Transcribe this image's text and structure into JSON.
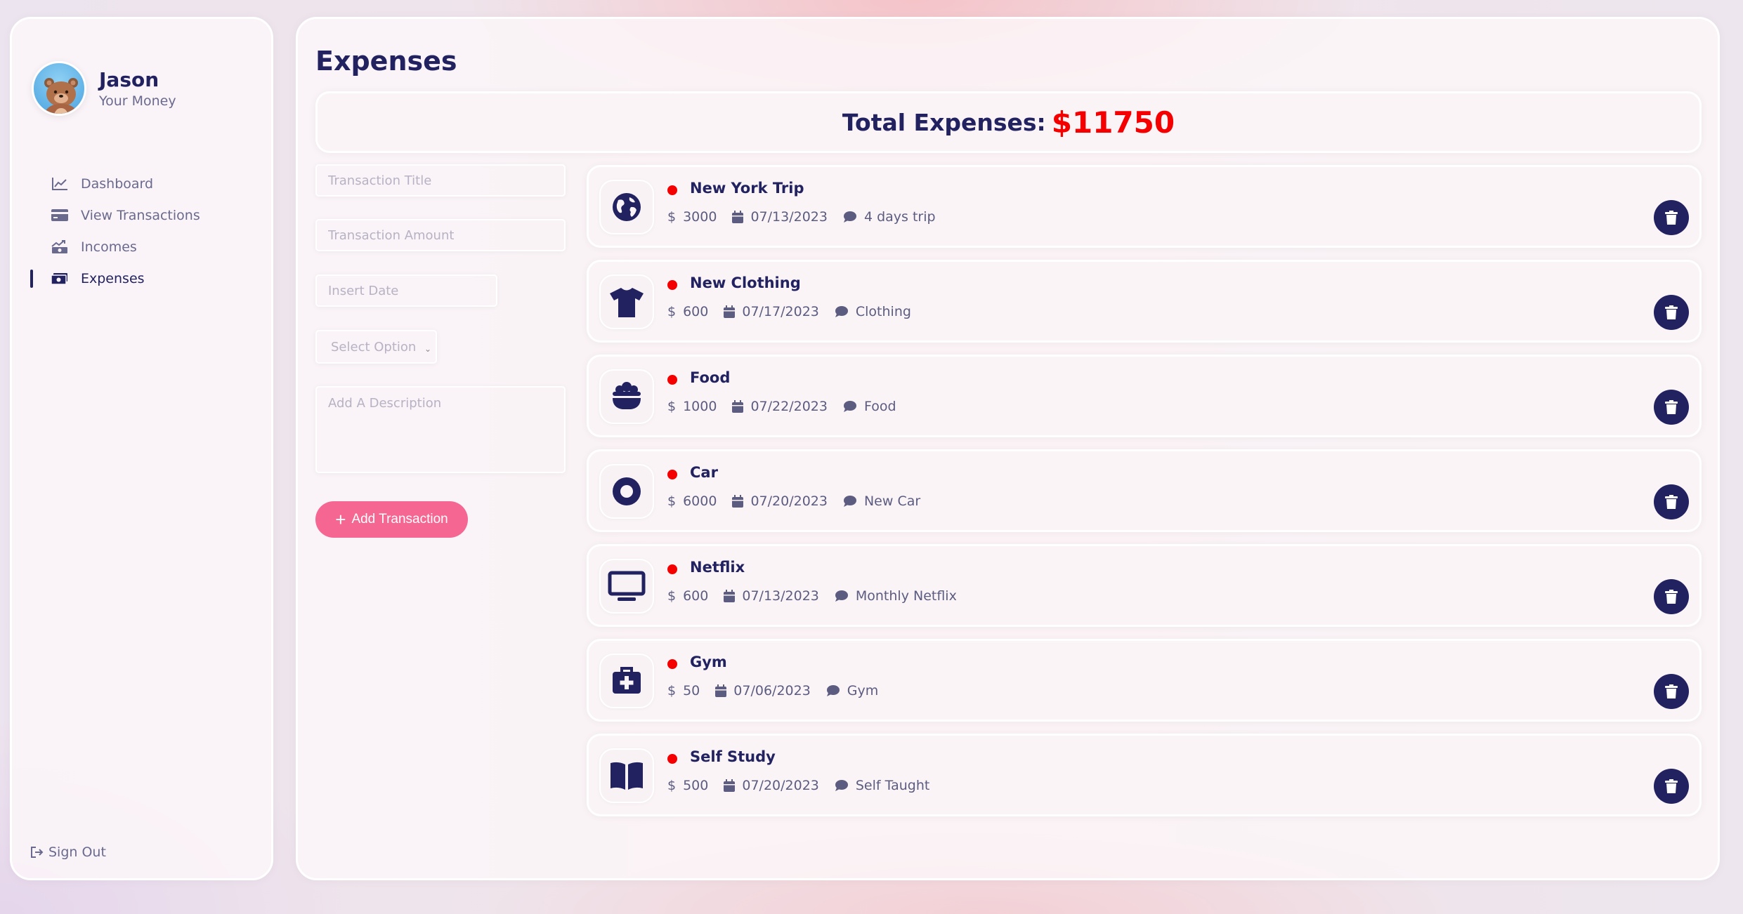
{
  "colors": {
    "primary": "#222260",
    "accent_pink": "#f56692",
    "expense_red": "#f40000",
    "muted_text": "#6a6a8e"
  },
  "user": {
    "name": "Jason",
    "subtitle": "Your Money"
  },
  "menu": [
    {
      "label": "Dashboard",
      "icon": "line-chart-icon",
      "active": false
    },
    {
      "label": "View Transactions",
      "icon": "credit-card-icon",
      "active": false
    },
    {
      "label": "Incomes",
      "icon": "money-trend-up-icon",
      "active": false
    },
    {
      "label": "Expenses",
      "icon": "money-bill-icon",
      "active": true
    }
  ],
  "signout_label": "Sign Out",
  "page": {
    "title": "Expenses",
    "total_label": "Total Expenses:",
    "total_value": "$11750"
  },
  "form": {
    "title_placeholder": "Transaction Title",
    "amount_placeholder": "Transaction Amount",
    "date_placeholder": "Insert Date",
    "select_value": "Select Option",
    "description_placeholder": "Add A Description",
    "add_button_label": "Add Transaction"
  },
  "expenses": [
    {
      "title": "New York Trip",
      "amount": "3000",
      "date": "07/13/2023",
      "description": "4 days trip",
      "icon": "globe-icon"
    },
    {
      "title": "New Clothing",
      "amount": "600",
      "date": "07/17/2023",
      "description": "Clothing",
      "icon": "tshirt-icon"
    },
    {
      "title": "Food",
      "amount": "1000",
      "date": "07/22/2023",
      "description": "Food",
      "icon": "food-bowl-icon"
    },
    {
      "title": "Car",
      "amount": "6000",
      "date": "07/20/2023",
      "description": "New Car",
      "icon": "car-wheel-icon"
    },
    {
      "title": "Netflix",
      "amount": "600",
      "date": "07/13/2023",
      "description": "Monthly Netflix",
      "icon": "tv-icon"
    },
    {
      "title": "Gym",
      "amount": "50",
      "date": "07/06/2023",
      "description": "Gym",
      "icon": "medical-kit-icon"
    },
    {
      "title": "Self Study",
      "amount": "500",
      "date": "07/20/2023",
      "description": "Self Taught",
      "icon": "book-icon"
    }
  ]
}
